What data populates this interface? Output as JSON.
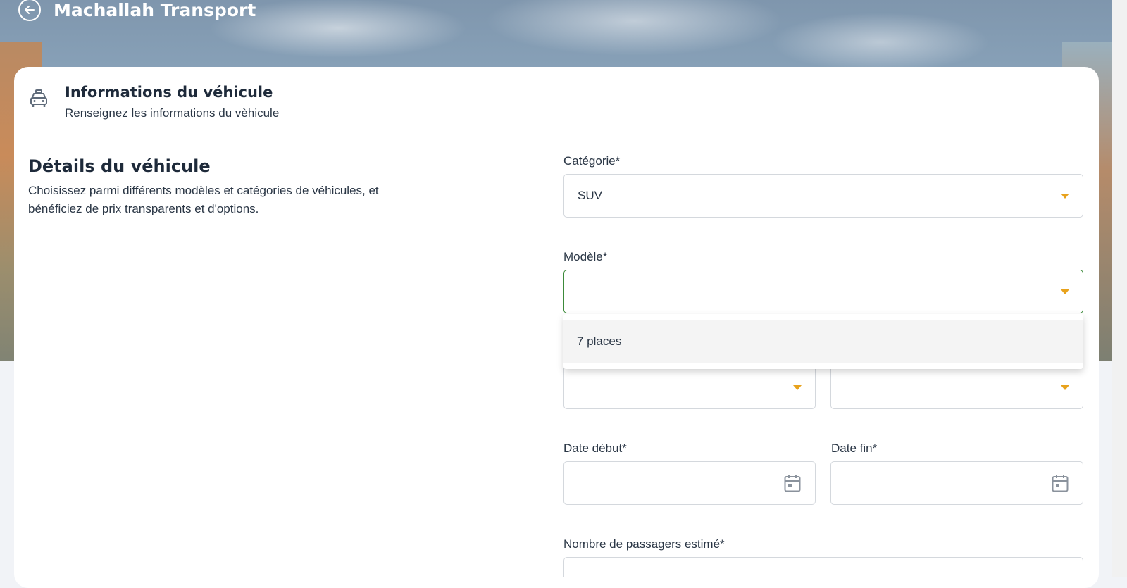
{
  "app": {
    "title": "Machallah Transport"
  },
  "card": {
    "title": "Informations du véhicule",
    "subtitle": "Renseignez les informations du vèhicule"
  },
  "section": {
    "title": "Détails du véhicule",
    "description": "Choisissez parmi différents modèles et catégories de véhicules, et bénéficiez de prix transparents et d'options."
  },
  "form": {
    "categorie": {
      "label": "Catégorie*",
      "value": "SUV"
    },
    "modele": {
      "label": "Modèle*",
      "value": ""
    },
    "modele_options": [
      "7 places"
    ],
    "date_debut": {
      "label": "Date début*",
      "value": ""
    },
    "date_fin": {
      "label": "Date fin*",
      "value": ""
    },
    "passagers": {
      "label": "Nombre de passagers estimé*",
      "value": ""
    }
  },
  "colors": {
    "accent_caret": "#e8a21c",
    "focus_border": "#3c8a3a",
    "heading": "#1e2a3a"
  },
  "icons": [
    "arrow-left-icon",
    "taxi-car-icon",
    "chevron-down-icon",
    "calendar-icon"
  ]
}
